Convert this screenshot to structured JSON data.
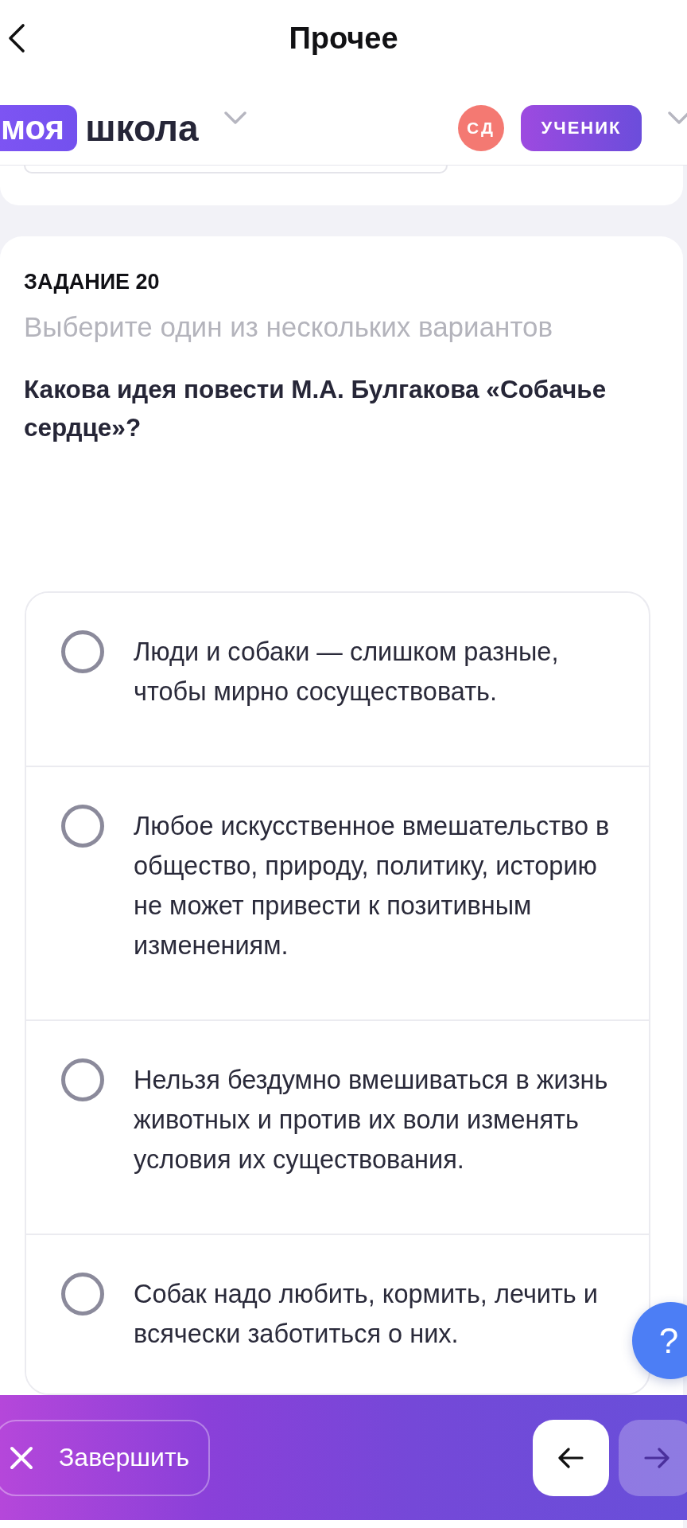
{
  "nav": {
    "title": "Прочее"
  },
  "header": {
    "logo": {
      "badge": "моя",
      "text": "школа"
    },
    "avatar": "СД",
    "role": "УЧЕНИК"
  },
  "task": {
    "label": "ЗАДАНИЕ 20",
    "instruction": "Выберите один из нескольких вариантов",
    "question": "Какова идея повести М.А. Булгакова «Собачье сердце»?",
    "options": [
      {
        "text": "Люди и собаки — слишком разные, чтобы мирно сосуществовать.",
        "selected": false
      },
      {
        "text": "Любое искусственное вмешательство в общество, природу, политику, историю не может привести к позитивным изменениям.",
        "selected": false
      },
      {
        "text": "Нельзя бездумно вмешиваться в жизнь животных и против их воли изменять условия их существования.",
        "selected": false
      },
      {
        "text": "Собак надо любить, кормить, лечить и всячески заботиться о них.",
        "selected": false
      }
    ]
  },
  "help": {
    "label": "?"
  },
  "footer": {
    "finish": "Завершить",
    "prev": {
      "disabled": false
    },
    "next": {
      "disabled": true
    }
  }
}
